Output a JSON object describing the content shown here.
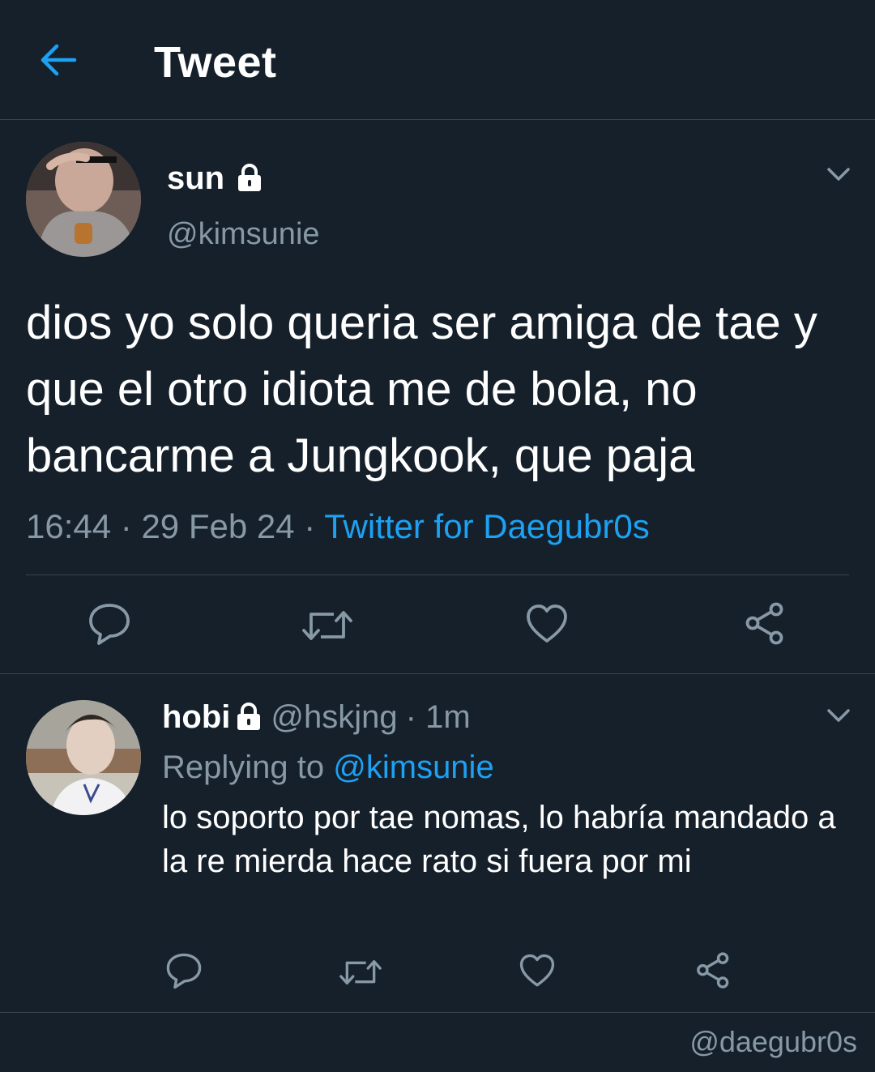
{
  "header": {
    "title": "Tweet",
    "back_icon": "arrow-left-icon"
  },
  "tweet": {
    "name": "sun",
    "handle": "@kimsunie",
    "text": "dios yo solo queria ser amiga de tae y que el otro idiota me de bola, no bancarme a Jungkook, que paja",
    "time": "16:44",
    "date": "29 Feb 24",
    "separator": "·",
    "source": "Twitter for Daegubr0s",
    "actions": [
      "reply-icon",
      "retweet-icon",
      "like-icon",
      "share-icon"
    ]
  },
  "reply": {
    "name": "hobi",
    "handle": "@hskjng",
    "age": "· 1m",
    "replying_label": "Replying to",
    "replying_handle": "@kimsunie",
    "text": "lo soporto por tae nomas, lo habría mandado a la re mierda hace rato si fuera por mi"
  },
  "watermark": "@daegubr0s",
  "colors": {
    "background": "#15202b",
    "accent": "#1da1f2",
    "muted": "#8899a6",
    "divider": "#38444d",
    "text": "#ffffff"
  }
}
